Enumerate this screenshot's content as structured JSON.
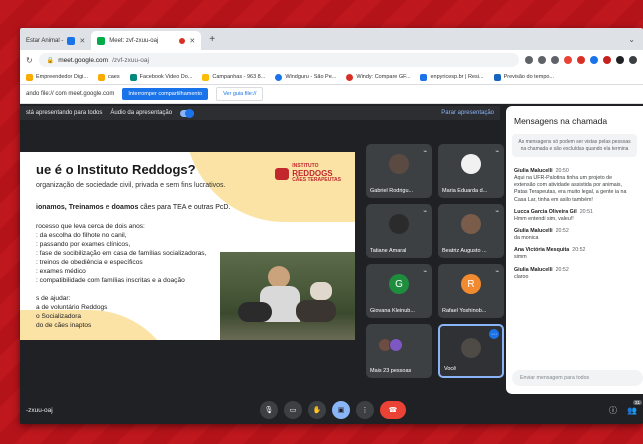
{
  "tabs": [
    {
      "label": "Estar Animal -",
      "active": false
    },
    {
      "label": "Meet: zvf-zxuu-oaj",
      "active": true
    }
  ],
  "address": {
    "host": "meet.google.com",
    "path": "/zvf-zxuu-oaj"
  },
  "bookmarks": [
    "Empreendedor Digi...",
    "caes",
    "Facebook Video Do...",
    "Campanhas - 963 8...",
    "Windguru - São Pe...",
    "Windy: Compare GF...",
    "enpyricesp.br | Resi...",
    "Previsão do tempo..."
  ],
  "sharebar": {
    "text": "ando file:// com meet.google.com",
    "stop_label": "Interromper compartilhamento",
    "view_label": "Ver guia file://"
  },
  "presbar": {
    "presenting": "stá apresentando para todos",
    "audio": "Áudio da apresentação",
    "stop": "Parar apresentação"
  },
  "slide": {
    "title": "ue é o Instituto Reddogs?",
    "subtitle": "organização de sociedade civil, privada e sem fins lucrativos.",
    "logo_top": "INSTITUTO",
    "logo_main": "REDDOGS",
    "logo_bottom": "CÃES TERAPEUTAS",
    "action_prefix": "ionamos, ",
    "action_verbs": "Treinamos",
    "action_mid": " e ",
    "action_last": "doamos",
    "action_suffix": " cães para TEA e outras PcD.",
    "lines": [
      "rocesso que leva cerca de dois anos:",
      ": da escolha do filhote no canil,",
      ": passando por exames clínicos,",
      ": fase de socibilização em casa de famílias socializadoras,",
      ": treinos de obediência e específicos",
      ": exames médico",
      ": compatibilidade com famílias inscritas e a doação",
      "s de ajudar:",
      "a de voluntário Reddogs",
      "o Socializadora",
      "do de cães inaptos"
    ]
  },
  "participants": [
    {
      "name": "Gabriel Rodrigu...",
      "type": "photo"
    },
    {
      "name": "Maria Eduarda d...",
      "type": "photo"
    },
    {
      "name": "Tatiane Amaral",
      "type": "photo"
    },
    {
      "name": "Beatriz Augusto ...",
      "type": "photo"
    },
    {
      "name": "Giovana Kleinub...",
      "type": "letter",
      "letter": "G",
      "color": "#1e8e3e"
    },
    {
      "name": "Rafael Yoshinob...",
      "type": "letter",
      "letter": "R",
      "color": "#f28b30"
    },
    {
      "name": "Mais 23 pessoas",
      "type": "more"
    },
    {
      "name": "Você",
      "type": "self"
    }
  ],
  "chat": {
    "title": "Mensagens na chamada",
    "note": "As mensagens só podem ser vistas pelas pessoas na chamada e são excluídas quando ela termina",
    "messages": [
      {
        "who": "Giulia Malucelli",
        "when": "20:50",
        "text": "Aqui na UFR-Palotina tinha um projeto de extensão com atividade assistida por animais, Patas Terapeutas, era muito legal, a gente ia na Casa Lar, tinha em asilo também!"
      },
      {
        "who": "Lucca Garcia Oliveira Gil",
        "when": "20:51",
        "text": "Hmm entendi sim, valeu!!"
      },
      {
        "who": "Giulia Malucelli",
        "when": "20:52",
        "text": "da monica"
      },
      {
        "who": "Ana Victória Mesquita",
        "when": "20:52",
        "text": "simm"
      },
      {
        "who": "Giulia Malucelli",
        "when": "20:52",
        "text": "claroo"
      }
    ],
    "input_placeholder": "Enviar mensagem para todos"
  },
  "bottom": {
    "meet_code": "-zxuu-oaj",
    "people_count": "31"
  }
}
